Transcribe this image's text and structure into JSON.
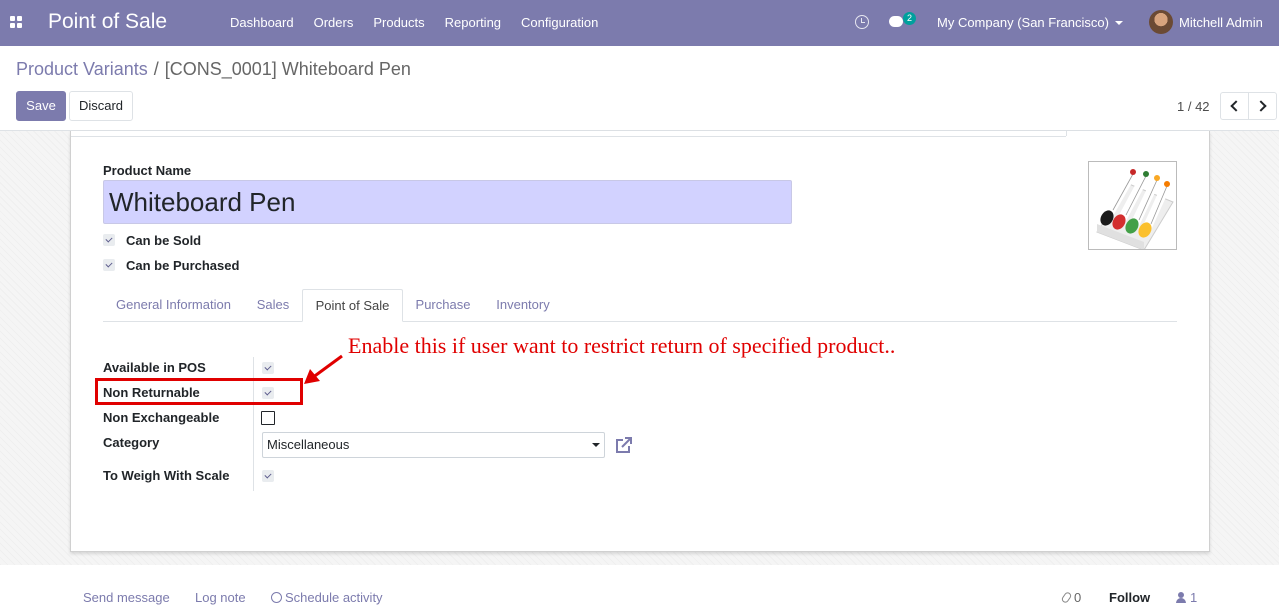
{
  "navbar": {
    "app_title": "Point of Sale",
    "menu": [
      "Dashboard",
      "Orders",
      "Products",
      "Reporting",
      "Configuration"
    ],
    "chat_badge": "2",
    "company": "My Company (San Francisco)",
    "user": "Mitchell Admin"
  },
  "breadcrumb": {
    "parent": "Product Variants",
    "separator": "/",
    "current": "[CONS_0001] Whiteboard Pen"
  },
  "buttons": {
    "save": "Save",
    "discard": "Discard"
  },
  "pager": {
    "value": "1 / 42"
  },
  "form": {
    "product_name_label": "Product Name",
    "product_name": "Whiteboard Pen",
    "can_be_sold": {
      "label": "Can be Sold",
      "checked": true
    },
    "can_be_purchased": {
      "label": "Can be Purchased",
      "checked": true
    },
    "tabs": [
      "General Information",
      "Sales",
      "Point of Sale",
      "Purchase",
      "Inventory"
    ],
    "active_tab": "Point of Sale",
    "pos_fields": {
      "available_in_pos": {
        "label": "Available in POS",
        "checked": true
      },
      "non_returnable": {
        "label": "Non Returnable",
        "checked": true
      },
      "non_exchangeable": {
        "label": "Non Exchangeable",
        "checked": false
      },
      "category": {
        "label": "Category",
        "value": "Miscellaneous"
      },
      "to_weigh_with_scale": {
        "label": "To Weigh With Scale",
        "checked": true
      }
    }
  },
  "annotation": {
    "text": "Enable this if user want to restrict return of specified product..",
    "color": "#e00000"
  },
  "chatter": {
    "send_message": "Send message",
    "log_note": "Log note",
    "schedule_activity": "Schedule activity",
    "attachments": "0",
    "follow": "Follow",
    "followers": "1"
  },
  "colors": {
    "brand": "#7c7bad",
    "product_name_bg": "#d2d2ff",
    "annotation": "#e00000"
  },
  "icons": [
    "apps-icon",
    "clock-icon",
    "chat-icon",
    "caret-down-icon",
    "avatar",
    "chevron-left-icon",
    "chevron-right-icon",
    "external-link-icon",
    "clock-icon",
    "paperclip-icon",
    "user-icon"
  ]
}
